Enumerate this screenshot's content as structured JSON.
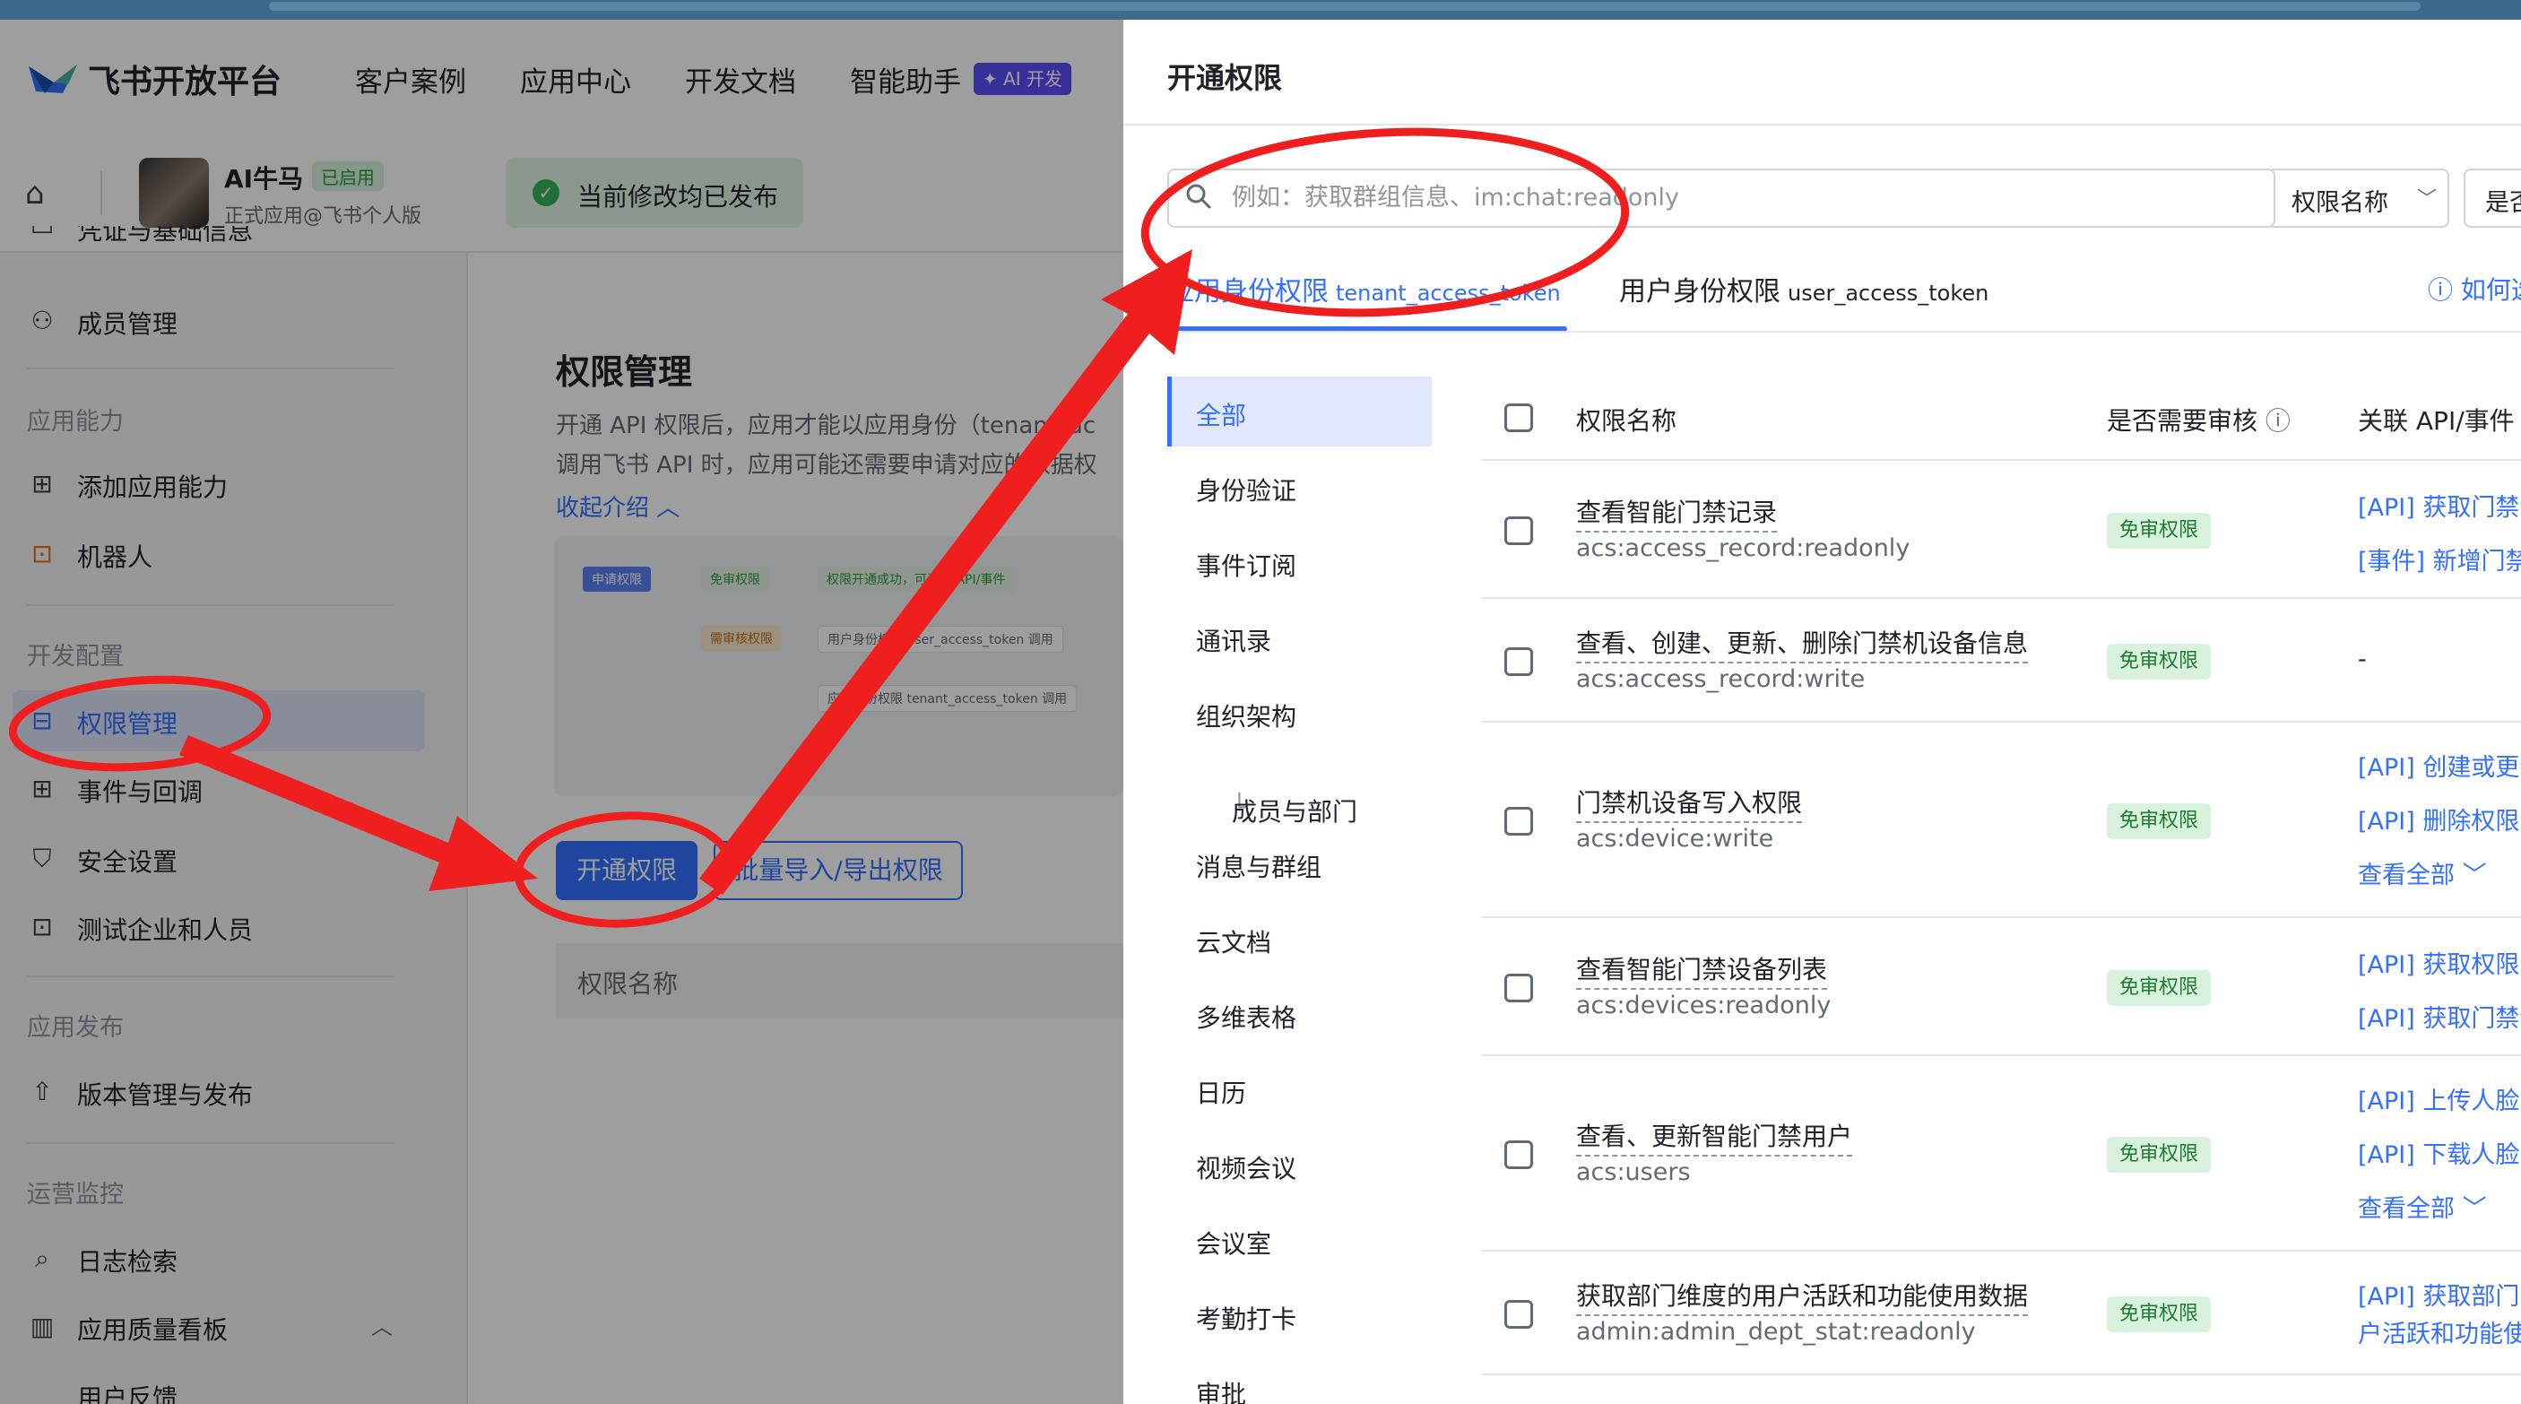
{
  "header": {
    "brand": "飞书开放平台",
    "nav": [
      "客户案例",
      "应用中心",
      "开发文档",
      "智能助手"
    ],
    "ai_badge": "✦ AI 开发"
  },
  "app": {
    "name": "AI牛马",
    "status": "已启用",
    "subtitle": "正式应用@飞书个人版",
    "publish_notice": "当前修改均已发布"
  },
  "sidebar": {
    "partial_top": "凭证与基础信息",
    "items": [
      {
        "label": "成员管理",
        "icon": "user-add-icon"
      },
      {
        "group": "应用能力"
      },
      {
        "label": "添加应用能力",
        "icon": "grid-icon"
      },
      {
        "label": "机器人",
        "icon": "robot-icon"
      },
      {
        "group": "开发配置"
      },
      {
        "label": "权限管理",
        "icon": "permission-icon",
        "active": true
      },
      {
        "label": "事件与回调",
        "icon": "event-icon"
      },
      {
        "label": "安全设置",
        "icon": "shield-icon"
      },
      {
        "label": "测试企业和人员",
        "icon": "test-icon"
      },
      {
        "group": "应用发布"
      },
      {
        "label": "版本管理与发布",
        "icon": "upload-icon"
      },
      {
        "group": "运营监控"
      },
      {
        "label": "日志检索",
        "icon": "log-search-icon"
      },
      {
        "label": "应用质量看板",
        "icon": "chart-icon"
      },
      {
        "label": "用户反馈",
        "icon": "feedback-icon"
      }
    ]
  },
  "content": {
    "title": "权限管理",
    "desc1": "开通 API 权限后，应用才能以应用身份（tenant_ac",
    "desc2": "调用飞书 API 时，应用可能还需要申请对应的数据权",
    "collapse": "收起介绍",
    "flow": {
      "apply": "申请权限",
      "no_review": "免审权限",
      "opened": "权限开通成功，可调用 API/事件",
      "need_review": "需审核权限",
      "user_identity": "用户身份权限 user_access_token 调用",
      "app_identity": "应用身份权限 tenant_access_token 调用"
    },
    "open_btn": "开通权限",
    "batch_btn": "批量导入/导出权限",
    "table_head": "权限名称"
  },
  "drawer": {
    "title": "开通权限",
    "search_placeholder": "例如：获取群组信息、im:chat:readonly",
    "field_select": "权限名称",
    "review_select": "是否需要审核",
    "tab_tenant": "应用身份权限",
    "tab_tenant_token": "tenant_access_token",
    "tab_user": "用户身份权限",
    "tab_user_token": "user_access_token",
    "help": "如何选择",
    "categories": [
      "全部",
      "身份验证",
      "事件订阅",
      "通讯录",
      "组织架构",
      "成员与部门",
      "消息与群组",
      "云文档",
      "多维表格",
      "日历",
      "视频会议",
      "会议室",
      "考勤打卡",
      "审批"
    ],
    "columns": [
      "权限名称",
      "是否需要审核",
      "关联 API/事件"
    ],
    "rows": [
      {
        "name": "查看智能门禁记录",
        "code": "acs:access_record:readonly",
        "tag": "免审权限",
        "apis": [
          "[API] 获取门禁记录列表",
          "[事件] 新增门禁记录"
        ]
      },
      {
        "name": "查看、创建、更新、删除门禁机设备信息",
        "code": "acs:access_record:write",
        "tag": "免审权限",
        "apis": [
          "-"
        ]
      },
      {
        "name": "门禁机设备写入权限",
        "code": "acs:device:write",
        "tag": "免审权限",
        "apis": [
          "[API] 创建或更新权限组",
          "[API] 删除权限组",
          "查看全部"
        ]
      },
      {
        "name": "查看智能门禁设备列表",
        "code": "acs:devices:readonly",
        "tag": "免审权限",
        "apis": [
          "[API] 获取权限组信息",
          "[API] 获取门禁设备列表"
        ]
      },
      {
        "name": "查看、更新智能门禁用户",
        "code": "acs:users",
        "tag": "免审权限",
        "apis": [
          "[API] 上传人脸图片",
          "[API] 下载人脸图片",
          "查看全部"
        ]
      },
      {
        "name": "获取部门维度的用户活跃和功能使用数据",
        "code": "admin:admin_dept_stat:readonly",
        "tag": "免审权限",
        "apis": [
          "[API] 获取部门维度的用",
          "户活跃和功能使用数据"
        ]
      }
    ]
  },
  "colors": {
    "accent": "#3370ff",
    "annotation_red": "#f01f1f",
    "tag_green_bg": "#d9f2dd"
  }
}
